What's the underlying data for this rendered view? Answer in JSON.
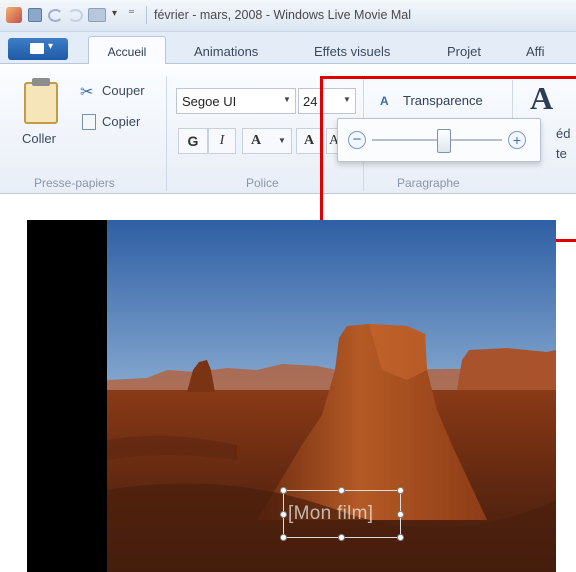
{
  "window": {
    "title": "février - mars, 2008 - Windows Live Movie Mal"
  },
  "quick_access": {
    "icons": [
      "app-icon",
      "save-icon",
      "undo-icon",
      "redo-icon",
      "snapshot-icon",
      "dropdown-icon",
      "customize-icon"
    ],
    "dropdown_glyph": "▾",
    "customize_glyph": "⁼"
  },
  "tabs": {
    "app_menu_arrow": "▾",
    "items": [
      {
        "label": "Accueil",
        "active": true
      },
      {
        "label": "Animations"
      },
      {
        "label": "Effets visuels"
      },
      {
        "label": "Projet"
      },
      {
        "label": "Affi"
      }
    ]
  },
  "ribbon": {
    "clipboard": {
      "paste_label": "Coller",
      "cut_label": "Couper",
      "copy_label": "Copier",
      "group_label": "Presse-papiers"
    },
    "font": {
      "font_name": "Segoe UI",
      "font_size": "24",
      "bold_label": "G",
      "italic_label": "I",
      "color_label": "A",
      "grow_label": "A",
      "shrink_label": "A",
      "group_label": "Police"
    },
    "paragraph": {
      "transparency_icon": "A",
      "transparency_label": "Transparence",
      "group_label": "Paragraphe"
    },
    "edit_text": {
      "big_icon": "A",
      "edit_label": "éd",
      "text_label": "te"
    }
  },
  "slider_popup": {
    "minus": "−",
    "plus": "+",
    "value_fraction": 0.55
  },
  "preview": {
    "title_text": "[Mon film]"
  },
  "colors": {
    "highlight": "#e00000",
    "accent": "#1f5aa8"
  }
}
